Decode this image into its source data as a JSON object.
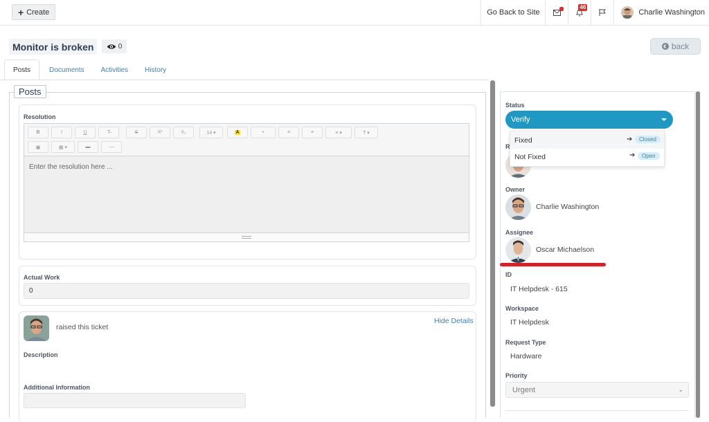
{
  "topbar": {
    "create_label": "Create",
    "go_back_label": "Go Back to Site",
    "mail_badge": "",
    "notif_count": "46",
    "user_name": "Charlie Washington"
  },
  "ticket": {
    "title": "Monitor is broken",
    "watch_count": "0",
    "back_label": "back"
  },
  "tabs": [
    {
      "label": "Posts",
      "active": true
    },
    {
      "label": "Documents"
    },
    {
      "label": "Activities"
    },
    {
      "label": "History"
    }
  ],
  "posts": {
    "legend": "Posts",
    "resolution_label": "Resolution",
    "resolution_placeholder": "Enter the resolution here ...",
    "toolbar_row1": [
      "B",
      "I",
      "U",
      "T̶",
      "S",
      "X²",
      "X₂",
      "14 ▾",
      "A",
      "•",
      "≡",
      "≡",
      "≡ ▾",
      "T ▾"
    ],
    "toolbar_row2": [
      "▣",
      "▦ ▾",
      "▬",
      "—"
    ],
    "actual_work_label": "Actual Work",
    "actual_work_value": "0",
    "raised_text": "raised this ticket",
    "hide_details": "Hide Details",
    "description_label": "Description",
    "additional_info_label": "Additional Information"
  },
  "side": {
    "status_label": "Status",
    "status_value": "Verify",
    "dropdown": [
      {
        "label": "Fixed",
        "target": "Closed"
      },
      {
        "label": "Not Fixed",
        "target": "Open"
      }
    ],
    "requester_label_fragment": "R",
    "owner_label": "Owner",
    "owner_name": "Charlie Washington",
    "assignee_label": "Assignee",
    "assignee_name": "Oscar Michaelson",
    "id_label": "ID",
    "id_value": "IT Helpdesk - 615",
    "workspace_label": "Workspace",
    "workspace_value": "IT Helpdesk",
    "request_type_label": "Request Type",
    "request_type_value": "Hardware",
    "priority_label": "Priority",
    "priority_value": "Urgent"
  },
  "colors": {
    "status_select_bg": "#1f98c4",
    "link": "#3f7fb1",
    "annotation_red": "#d81f26",
    "badge_red": "#d9302c"
  },
  "icons": [
    "plus-icon",
    "mail-icon",
    "bell-icon",
    "flag-icon",
    "eye-icon",
    "back-circle-icon",
    "arrow-right-icon",
    "caret-down-icon"
  ]
}
